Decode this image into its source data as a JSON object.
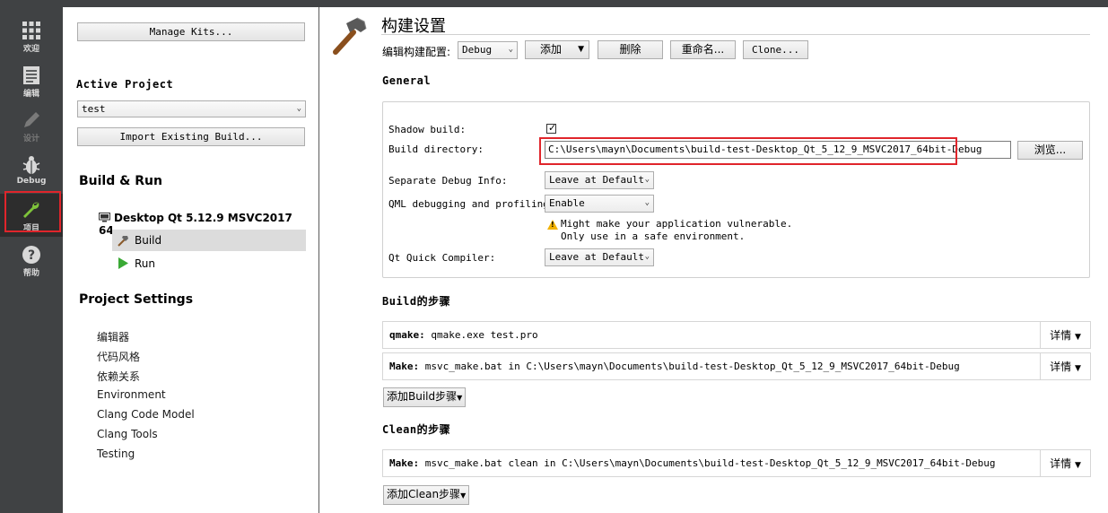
{
  "modebar": {
    "items": [
      {
        "label": "欢迎",
        "icon": "grid-icon"
      },
      {
        "label": "编辑",
        "icon": "document-icon"
      },
      {
        "label": "设计",
        "icon": "pencil-icon"
      },
      {
        "label": "Debug",
        "icon": "bug-icon"
      },
      {
        "label": "项目",
        "icon": "wrench-icon"
      },
      {
        "label": "帮助",
        "icon": "help-icon"
      }
    ],
    "active": "项目"
  },
  "leftpane": {
    "manage_kits": "Manage Kits...",
    "active_project_title": "Active Project",
    "active_project_value": "test",
    "import_build": "Import Existing Build...",
    "build_run_title": "Build & Run",
    "kit_name": "Desktop Qt 5.12.9 MSVC2017 64...",
    "kit_children": [
      "Build",
      "Run"
    ],
    "project_settings_title": "Project Settings",
    "project_settings_items": [
      "编辑器",
      "代码风格",
      "依赖关系",
      "Environment",
      "Clang Code Model",
      "Clang Tools",
      "Testing"
    ]
  },
  "main": {
    "title": "构建设置",
    "config_label": "编辑构建配置:",
    "config_value": "Debug",
    "add_button": "添加",
    "delete_button": "删除",
    "rename_button": "重命名...",
    "clone_button": "Clone...",
    "general_title": "General",
    "shadow_build_label": "Shadow build:",
    "shadow_build_checked": true,
    "build_dir_label": "Build directory:",
    "build_dir_value": "C:\\Users\\mayn\\Documents\\build-test-Desktop_Qt_5_12_9_MSVC2017_64bit-Debug",
    "browse_button": "浏览...",
    "sep_debug_label": "Separate Debug Info:",
    "sep_debug_value": "Leave at Default",
    "qml_debug_label": "QML debugging and profiling:",
    "qml_debug_value": "Enable",
    "warning_line1": "Might make your application vulnerable.",
    "warning_line2": "Only use in a safe environment.",
    "qtquick_label": "Qt Quick Compiler:",
    "qtquick_value": "Leave at Default",
    "build_steps_title": "Build的步骤",
    "build_steps": [
      {
        "name": "qmake:",
        "cmd": "qmake.exe test.pro",
        "details": "详情"
      },
      {
        "name": "Make:",
        "cmd": "msvc_make.bat in C:\\Users\\mayn\\Documents\\build-test-Desktop_Qt_5_12_9_MSVC2017_64bit-Debug",
        "details": "详情"
      }
    ],
    "add_build_step": "添加Build步骤",
    "clean_steps_title": "Clean的步骤",
    "clean_steps": [
      {
        "name": "Make:",
        "cmd": "msvc_make.bat clean in C:\\Users\\mayn\\Documents\\build-test-Desktop_Qt_5_12_9_MSVC2017_64bit-Debug",
        "details": "详情"
      }
    ],
    "add_clean_step": "添加Clean步骤"
  },
  "colors": {
    "modebar_bg": "#404244",
    "highlight_red": "#e0252b",
    "run_green": "#3aa935",
    "wrench_green": "#7ec33a",
    "warning_yellow": "#f2b200"
  }
}
